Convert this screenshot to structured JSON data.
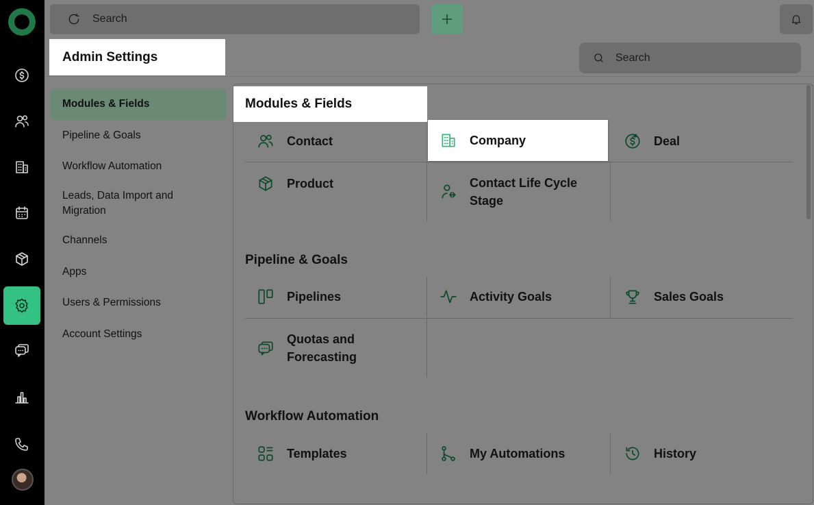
{
  "topbar": {
    "search_placeholder": "Search"
  },
  "header": {
    "title": "Admin Settings",
    "search_placeholder": "Search"
  },
  "sidenav": [
    {
      "label": "Modules & Fields"
    },
    {
      "label": "Pipeline & Goals"
    },
    {
      "label": "Workflow Automation"
    },
    {
      "label": "Leads, Data Import and Migration"
    },
    {
      "label": "Channels"
    },
    {
      "label": "Apps"
    },
    {
      "label": "Users & Permissions"
    },
    {
      "label": "Account Settings"
    }
  ],
  "sections": [
    {
      "title": "Modules & Fields",
      "items": [
        {
          "label": "Contact",
          "icon": "contacts-icon"
        },
        {
          "label": "Company",
          "icon": "building-icon"
        },
        {
          "label": "Deal",
          "icon": "deal-icon"
        },
        {
          "label": "Product",
          "icon": "box-icon"
        },
        {
          "label": "Contact Life Cycle Stage",
          "icon": "lifecycle-icon"
        }
      ]
    },
    {
      "title": "Pipeline & Goals",
      "items": [
        {
          "label": "Pipelines",
          "icon": "pipelines-icon"
        },
        {
          "label": "Activity Goals",
          "icon": "activity-icon"
        },
        {
          "label": "Sales Goals",
          "icon": "trophy-icon"
        },
        {
          "label": "Quotas and Forecasting",
          "icon": "forecast-icon"
        }
      ]
    },
    {
      "title": "Workflow Automation",
      "items": [
        {
          "label": "Templates",
          "icon": "templates-icon"
        },
        {
          "label": "My Automations",
          "icon": "automation-icon"
        },
        {
          "label": "History",
          "icon": "history-icon"
        }
      ]
    }
  ],
  "colors": {
    "accent": "#33c284",
    "icon_green": "#0d4a2c",
    "overlay_bg": "#838383"
  }
}
